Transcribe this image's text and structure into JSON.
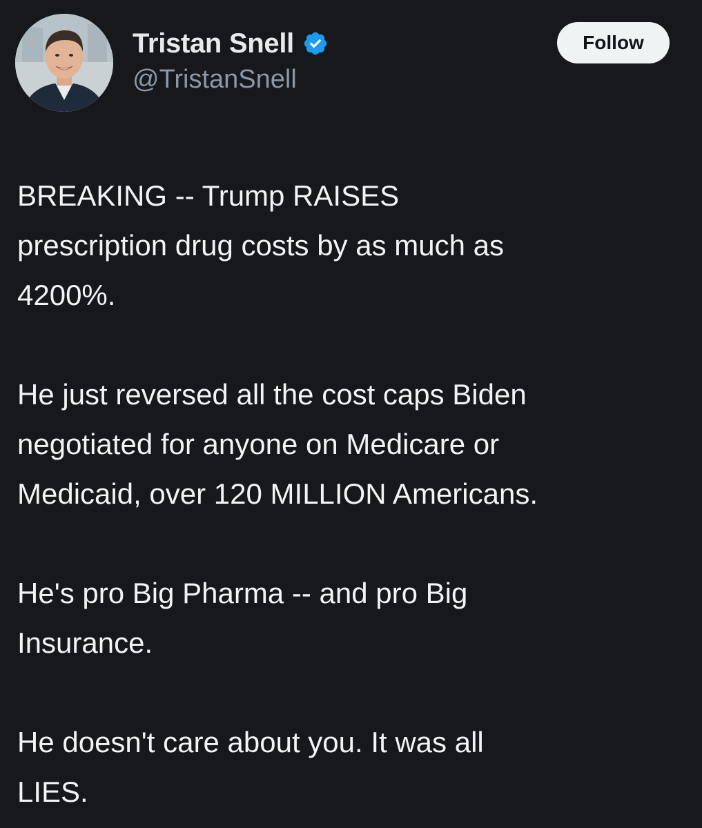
{
  "author": {
    "display_name": "Tristan Snell",
    "handle": "@TristanSnell",
    "avatar_icon": "profile-photo-avatar",
    "verified_icon": "verified-badge-icon",
    "verified_color": "#1d9bf0"
  },
  "actions": {
    "follow_label": "Follow"
  },
  "tweet": {
    "paragraphs": [
      "BREAKING -- Trump RAISES\nprescription drug costs by as much as\n4200%.",
      "He just reversed all the cost caps Biden\nnegotiated for anyone on Medicare or\nMedicaid, over 120 MILLION Americans.",
      "He's pro Big Pharma -- and pro Big\nInsurance.",
      "He doesn't care about you.  It was all\nLIES."
    ]
  },
  "colors": {
    "background": "#16181c",
    "text": "#e7e9ea",
    "secondary_text": "#8b98a5",
    "button_bg": "#eff3f4"
  }
}
